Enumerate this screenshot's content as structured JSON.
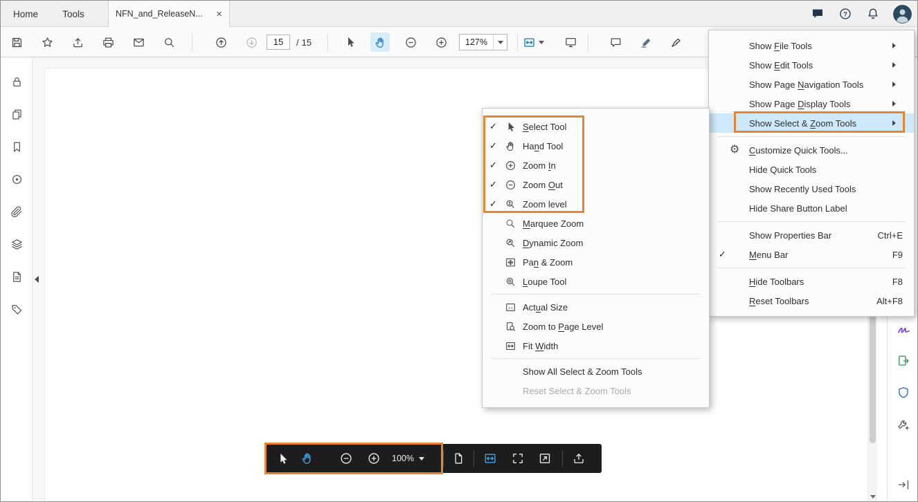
{
  "tabbar": {
    "home": "Home",
    "tools": "Tools",
    "document_tab": "NFN_and_ReleaseN...",
    "close_glyph": "×",
    "right_icons": [
      "chat-icon",
      "help-icon",
      "notifications-icon",
      "user-avatar"
    ]
  },
  "toolbar": {
    "icons": [
      "save-icon",
      "star-icon",
      "share-upload-icon",
      "print-icon",
      "email-icon",
      "search-icon",
      "page-up-icon",
      "page-down-icon",
      "select-tool-icon",
      "hand-tool-icon",
      "zoom-out-icon",
      "zoom-in-icon",
      "page-display-icon",
      "presentation-mode-icon",
      "comment-icon",
      "highlight-icon",
      "sign-pen-icon"
    ],
    "page_current": "15",
    "page_divider": "/",
    "page_total": "15",
    "zoom_level": "127%"
  },
  "left_rail_icons": [
    "lock-icon",
    "page-thumbnails-icon",
    "bookmarks-icon",
    "destinations-icon",
    "attachments-icon",
    "layers-icon",
    "content-icon",
    "tags-icon"
  ],
  "right_rail_icons": [
    "fill-and-sign-icon",
    "export-pdf-icon",
    "protect-shield-icon",
    "more-tools-wrench-icon",
    "open-tools-pane-icon"
  ],
  "context_menu": {
    "items": [
      {
        "pre": "Show ",
        "key": "F",
        "post": "ile Tools"
      },
      {
        "pre": "Show ",
        "key": "E",
        "post": "dit Tools"
      },
      {
        "pre": "Show Page ",
        "key": "N",
        "post": "avigation Tools"
      },
      {
        "pre": "Show Page ",
        "key": "D",
        "post": "isplay Tools"
      },
      {
        "pre": "Show Select & ",
        "key": "Z",
        "post": "oom Tools"
      },
      {
        "pre": "",
        "key": "C",
        "post": "ustomize Quick Tools...",
        "icon": "gear"
      },
      {
        "pre": "Hide Quick Tools",
        "key": "",
        "post": ""
      },
      {
        "pre": "Show Recently Used Tools",
        "key": "",
        "post": ""
      },
      {
        "pre": "Hide Share Button Label",
        "key": "",
        "post": ""
      },
      {
        "pre": "Show Properties Bar",
        "key": "",
        "post": "",
        "shortcut": "Ctrl+E"
      },
      {
        "pre": "",
        "key": "M",
        "post": "enu Bar",
        "shortcut": "F9",
        "checked": true
      },
      {
        "pre": "",
        "key": "H",
        "post": "ide Toolbars",
        "shortcut": "F8"
      },
      {
        "pre": "",
        "key": "R",
        "post": "eset Toolbars",
        "shortcut": "Alt+F8"
      }
    ]
  },
  "submenu": {
    "items": [
      {
        "icon": "select-tool",
        "checked": true,
        "pre": "",
        "key": "S",
        "post": "elect Tool"
      },
      {
        "icon": "hand-tool",
        "checked": true,
        "pre": "Ha",
        "key": "n",
        "post": "d Tool"
      },
      {
        "icon": "zoom-in",
        "checked": true,
        "pre": "Zoom ",
        "key": "I",
        "post": "n"
      },
      {
        "icon": "zoom-out",
        "checked": true,
        "pre": "Zoom ",
        "key": "O",
        "post": "ut"
      },
      {
        "icon": "zoom-level",
        "checked": true,
        "pre": "Zoom level",
        "key": "",
        "post": ""
      },
      {
        "icon": "marquee-zoom",
        "pre": "",
        "key": "M",
        "post": "arquee Zoom"
      },
      {
        "icon": "dynamic-zoom",
        "pre": "",
        "key": "D",
        "post": "ynamic Zoom"
      },
      {
        "icon": "pan-zoom",
        "pre": "Pa",
        "key": "n",
        "post": " & Zoom"
      },
      {
        "icon": "loupe",
        "pre": "",
        "key": "L",
        "post": "oupe Tool"
      },
      {
        "icon": "actual-size",
        "pre": "Act",
        "key": "u",
        "post": "al Size"
      },
      {
        "icon": "zoom-page-level",
        "pre": "Zoom to ",
        "key": "P",
        "post": "age Level"
      },
      {
        "icon": "fit-width",
        "pre": "Fit ",
        "key": "W",
        "post": "idth"
      },
      {
        "pre": "Show All Select & Zoom Tools",
        "key": "",
        "post": ""
      },
      {
        "pre": "Reset Select & Zoom Tools",
        "key": "",
        "post": "",
        "disabled": true
      }
    ]
  },
  "bottom_toolbar": {
    "zoom_level": "100%",
    "icons": [
      "select-tool-icon",
      "hand-tool-icon",
      "zoom-out-icon",
      "zoom-in-icon",
      "page-view-icon",
      "fit-width-icon",
      "fit-page-icon",
      "fullscreen-icon",
      "share-upload-icon"
    ]
  },
  "colors": {
    "highlight_orange": "#e8842c",
    "selection_blue": "#cde9fb",
    "hand_active_blue": "#1a7fd4",
    "dark_toolbar_bg": "#1d1d1d"
  }
}
